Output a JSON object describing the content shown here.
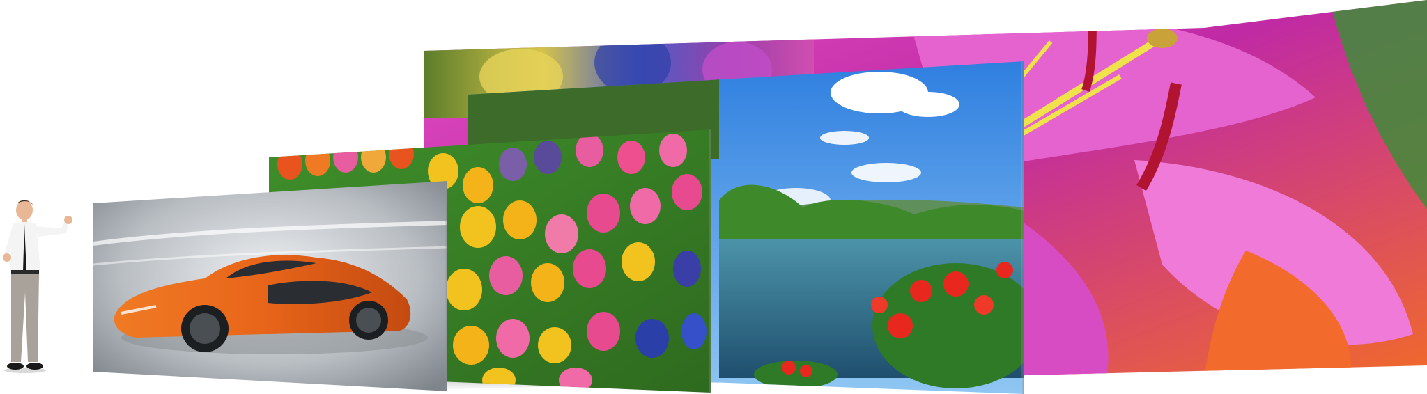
{
  "scene": {
    "subject": "product-showcase",
    "panels": [
      {
        "id": "lily",
        "content": "pink-lily-painting"
      },
      {
        "id": "floral-top",
        "content": "abstract-floral-painting"
      },
      {
        "id": "lake",
        "content": "lake-landscape-photo"
      },
      {
        "id": "tulips",
        "content": "tulips-photo"
      },
      {
        "id": "car",
        "content": "orange-sports-car-photo"
      }
    ],
    "person": {
      "content": "businessman-presenting"
    }
  },
  "colors": {
    "background": "#ffffff",
    "lily_pink": "#d43fb8",
    "lake_sky": "#3a8fe0",
    "lake_water": "#2f6f8f",
    "tulip_yellow": "#f2c21e",
    "car_orange": "#e8651a",
    "car_bg": "#b9bec3"
  }
}
